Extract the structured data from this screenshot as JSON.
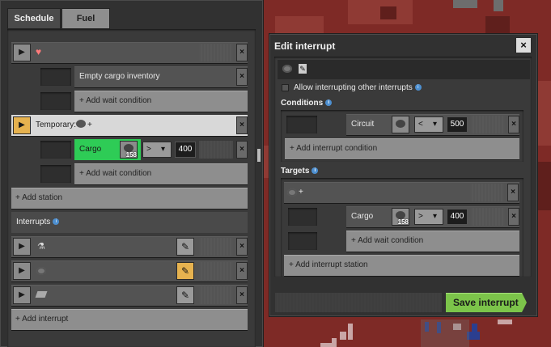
{
  "tabs": [
    {
      "label": "Schedule"
    },
    {
      "label": "Fuel"
    }
  ],
  "schedule": {
    "station1": {
      "icon": "heart-icon"
    },
    "wait_empty": {
      "label": "Empty cargo inventory"
    },
    "add_wait_1": {
      "label": "+ Add wait condition"
    },
    "temporary": {
      "label": "Temporary:",
      "suffix": "+"
    },
    "cargo_condition": {
      "label": "Cargo",
      "badge": "158",
      "op": ">",
      "value": "400"
    },
    "add_wait_2": {
      "label": "+ Add wait condition"
    },
    "add_station": {
      "label": "+ Add station"
    }
  },
  "interrupts": {
    "heading": "Interrupts",
    "items": [
      {
        "icon": "flask-icon"
      },
      {
        "icon": "ore-icon"
      },
      {
        "icon": "plate-icon"
      }
    ],
    "add": {
      "label": "+ Add interrupt"
    }
  },
  "dialog": {
    "title": "Edit interrupt",
    "allow_label": "Allow interrupting other interrupts",
    "conditions_heading": "Conditions",
    "circuit": {
      "label": "Circuit",
      "op": "<",
      "value": "500"
    },
    "add_condition": {
      "label": "+ Add interrupt condition"
    },
    "targets_heading": "Targets",
    "target_suffix": "+",
    "cargo": {
      "label": "Cargo",
      "badge": "158",
      "op": ">",
      "value": "400"
    },
    "add_wait": {
      "label": "+ Add wait condition"
    },
    "add_station": {
      "label": "+ Add interrupt station"
    },
    "save": {
      "label": "Save interrupt"
    }
  },
  "colors": {
    "accent": "#e6b24f",
    "green": "#2ecc56",
    "save": "#7cc44a"
  }
}
